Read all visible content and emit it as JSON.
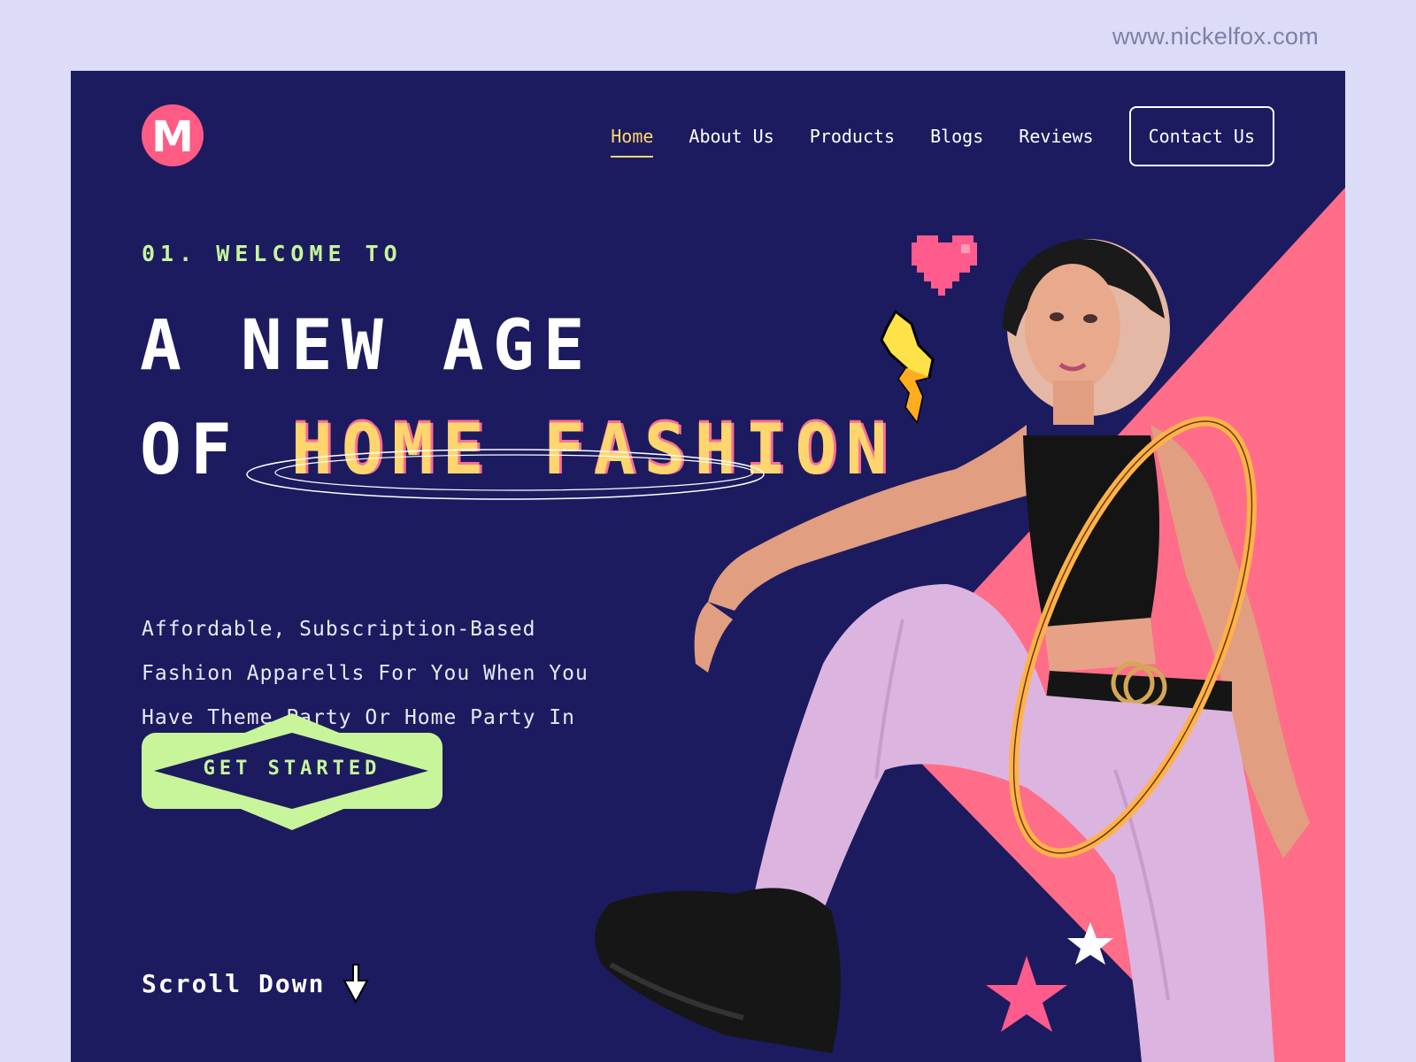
{
  "watermark": "www.nickelfox.com",
  "logo": {
    "letter": "M"
  },
  "nav": {
    "items": [
      {
        "label": "Home",
        "active": true
      },
      {
        "label": "About Us",
        "active": false
      },
      {
        "label": "Products",
        "active": false
      },
      {
        "label": "Blogs",
        "active": false
      },
      {
        "label": "Reviews",
        "active": false
      }
    ],
    "contact_label": "Contact Us"
  },
  "hero": {
    "eyebrow": "01. WELCOME TO",
    "headline_line1": "A NEW AGE",
    "headline_line2_prefix": "OF ",
    "headline_highlight": "HOME FASHION",
    "description": "Affordable, Subscription-Based Fashion Apparells For You When You Have Theme Party Or Home Party In Your Home.",
    "cta_label": "GET STARTED",
    "scroll_label": "Scroll Down"
  },
  "colors": {
    "background": "#dcdcf8",
    "frame": "#1d1b5f",
    "accent_pink": "#ff6d88",
    "accent_yellow": "#ffd66e",
    "accent_green": "#c8f59a"
  },
  "icons": {
    "logo": "m-logo-icon",
    "scroll": "pixel-cursor-icon",
    "heart": "pixel-heart-icon",
    "bolt": "pixel-lightning-icon",
    "star_white": "star-icon",
    "star_pink": "star-icon",
    "ring": "orbit-ring-icon"
  }
}
